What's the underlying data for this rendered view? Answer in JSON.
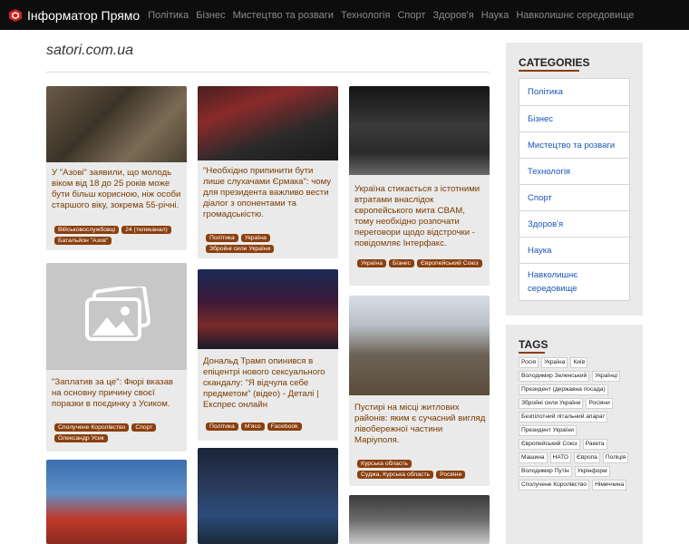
{
  "nav": {
    "brand": "Інформатор Прямо",
    "items": [
      {
        "label": "Політика"
      },
      {
        "label": "Бізнес"
      },
      {
        "label": "Мистецтво та розваги"
      },
      {
        "label": "Технологія"
      },
      {
        "label": "Спорт"
      },
      {
        "label": "Здоров'я"
      },
      {
        "label": "Наука"
      },
      {
        "label": "Навколишнє середовище"
      }
    ]
  },
  "site_title": "satori.com.ua",
  "cards": [
    {
      "headline": "У \"Азові\" заявили, що молодь віком від 18 до 25 років може бути більш корисною, ніж особи старшого віку, зокрема 55-річні.",
      "tags": [
        "Військовослужбовці",
        "24 (телеканал)",
        "Батальйон \"Азов\""
      ],
      "image": "photo"
    },
    {
      "headline": "\"Необхідно припинити бути лише слухачами Єрмака\": чому для президента важливо вести діалог з опонентами та громадськістю.",
      "tags": [
        "Політика",
        "Україна",
        "Збройні сили України"
      ],
      "image": "photo"
    },
    {
      "headline": "Україна стикається з істотними втратами внаслідок європейського мита CBAM, тому необхідно розпочати переговори щодо відстрочки - повідомляє Інтерфакс.",
      "tags": [
        "Україна",
        "Бізнес",
        "Європейський Союз"
      ],
      "image": "photo"
    },
    {
      "headline": "\"Заплатив за це\": Фюрі вказав на основну причину своєї поразки в поєдинку з Усиком.",
      "tags": [
        "Сполучене Королівство",
        "Спорт",
        "Олександр Усик"
      ],
      "image": "placeholder-icon"
    },
    {
      "headline": "Дональд Трамп опинився в епіцентрі нового сексуального скандалу: \"Я відчула себе предметом\" (відео) - Деталі | Експрес онлайн",
      "tags": [
        "Політика",
        "М'ясо",
        "Facebook"
      ],
      "image": "photo"
    },
    {
      "headline": "Пустирі на місці житлових районів: яким є сучасний вигляд лівобережної частини Маріуполя.",
      "tags": [
        "Курська область",
        "Суджа, Курська область",
        "Росіяни"
      ],
      "image": "photo"
    },
    {
      "headline": "",
      "tags": [],
      "image": "photo"
    },
    {
      "headline": "",
      "tags": [],
      "image": "photo"
    },
    {
      "headline": "",
      "tags": [],
      "image": "photo"
    }
  ],
  "sidebar": {
    "categories_title": "CATEGORIES",
    "categories": [
      "Політика",
      "Бізнес",
      "Мистецтво та розваги",
      "Технологія",
      "Спорт",
      "Здоров'я",
      "Наука",
      "Навколишнє середовище"
    ],
    "tags_title": "TAGS",
    "tags": [
      "Росія",
      "Україна",
      "Київ",
      "Володимир Зеленський",
      "Українці",
      "Президент (державна посада)",
      "Збройні сили України",
      "Росіяни",
      "Безпілотний літальний апарат",
      "Президент України",
      "Європейський Союз",
      "Ракета",
      "Машина",
      "НАТО",
      "Європа",
      "Поліція",
      "Володимир Путін",
      "Укрінформ",
      "Сполучене Королівство",
      "Німеччина"
    ]
  },
  "colors": {
    "accent": "#8b3f0d",
    "link": "#1a55b8",
    "topbar": "#0d0d0d"
  }
}
